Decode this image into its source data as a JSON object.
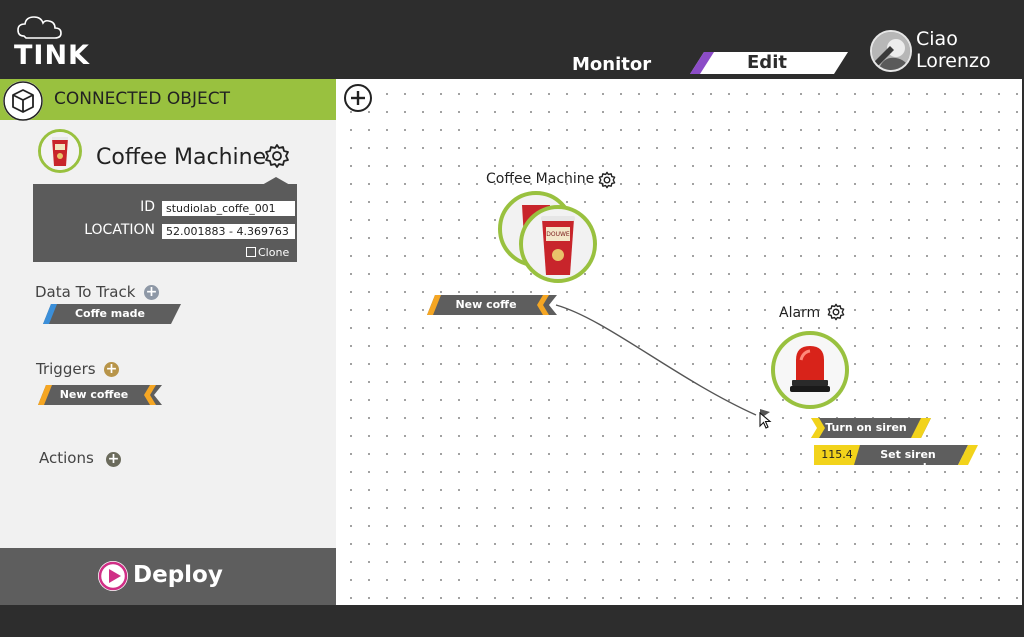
{
  "header": {
    "logo_text": "TINK",
    "tabs": [
      {
        "label": "Monitor",
        "active": false
      },
      {
        "label": "Edit",
        "active": true
      }
    ],
    "user": {
      "greeting_line1": "Ciao",
      "greeting_line2": "Lorenzo"
    }
  },
  "sidebar": {
    "header_title": "CONNECTED OBJECT",
    "object_name": "Coffee Machine",
    "id_label": "ID",
    "id_value": "studiolab_coffe_001",
    "location_label": "LOCATION",
    "location_value": "52.001883 - 4.369763",
    "clone_label": "Clone",
    "data_to_track": {
      "title": "Data To Track",
      "items": [
        "Coffe made"
      ]
    },
    "triggers": {
      "title": "Triggers",
      "items": [
        "New coffee"
      ]
    },
    "actions": {
      "title": "Actions",
      "items": []
    },
    "deploy_label": "Deploy"
  },
  "canvas": {
    "nodes": [
      {
        "title": "Coffee Machine",
        "outputs": [
          "New coffe"
        ]
      },
      {
        "title": "Alarm",
        "inputs": [
          {
            "label": "Turn on siren"
          },
          {
            "label": "Set siren speed",
            "value": "115.4"
          }
        ]
      }
    ]
  },
  "colors": {
    "brand_green": "#99c13f",
    "dark_bg": "#2d2d2d",
    "trigger_orange": "#f5a623",
    "action_yellow": "#f2d31b",
    "data_blue": "#3b8fd9",
    "deploy_pink": "#d02f86",
    "edit_purple": "#8b4cc7"
  },
  "icons": [
    "cloud-lightning-logo",
    "cube-icon",
    "gear-icon",
    "plus-icon",
    "play-icon",
    "clone-icon",
    "siren-icon",
    "coffee-cup-image",
    "cursor-icon"
  ]
}
